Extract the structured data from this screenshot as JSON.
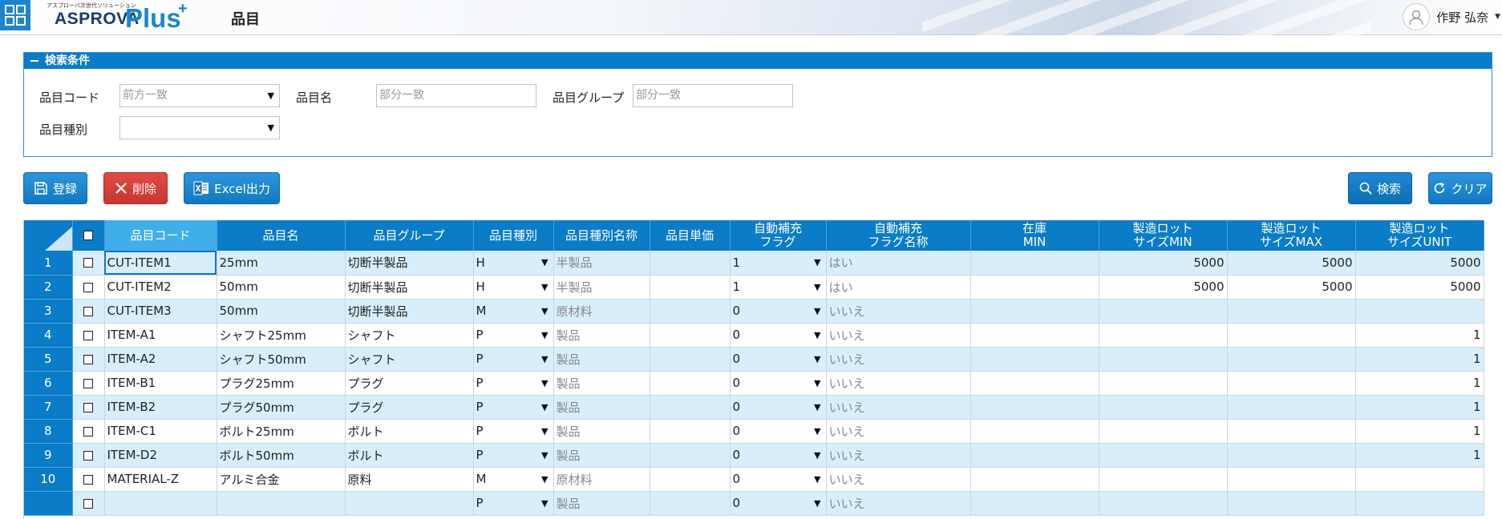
{
  "header": {
    "logo_sub": "アスプローバ次世代ソリューション",
    "logo_main": "ASPROVA",
    "logo_plus": "Plus",
    "logo_sup": "+",
    "page_title": "品目",
    "user_name": "作野 弘奈"
  },
  "search": {
    "panel_title": "検索条件",
    "item_code_label": "品目コード",
    "item_code_placeholder": "前方一致",
    "item_name_label": "品目名",
    "item_name_placeholder": "部分一致",
    "item_group_label": "品目グループ",
    "item_group_placeholder": "部分一致",
    "item_type_label": "品目種別",
    "item_type_value": ""
  },
  "toolbar": {
    "register": "登録",
    "delete": "削除",
    "excel": "Excel出力",
    "search": "検索",
    "clear": "クリア"
  },
  "grid": {
    "columns": [
      "品目コード",
      "品目名",
      "品目グループ",
      "品目種別",
      "品目種別名称",
      "品目単価",
      "自動補充\nフラグ",
      "自動補充\nフラグ名称",
      "在庫\nMIN",
      "製造ロット\nサイズMIN",
      "製造ロット\nサイズMAX",
      "製造ロット\nサイズUNIT"
    ],
    "rows": [
      {
        "no": "1",
        "code": "CUT-ITEM1",
        "name": "25mm",
        "group": "切断半製品",
        "type": "H",
        "type_name": "半製品",
        "price": "",
        "flag": "1",
        "flag_name": "はい",
        "stock_min": "",
        "lot_min": "5000",
        "lot_max": "5000",
        "lot_unit": "5000"
      },
      {
        "no": "2",
        "code": "CUT-ITEM2",
        "name": "50mm",
        "group": "切断半製品",
        "type": "H",
        "type_name": "半製品",
        "price": "",
        "flag": "1",
        "flag_name": "はい",
        "stock_min": "",
        "lot_min": "5000",
        "lot_max": "5000",
        "lot_unit": "5000"
      },
      {
        "no": "3",
        "code": "CUT-ITEM3",
        "name": "50mm",
        "group": "切断半製品",
        "type": "M",
        "type_name": "原材料",
        "price": "",
        "flag": "0",
        "flag_name": "いいえ",
        "stock_min": "",
        "lot_min": "",
        "lot_max": "",
        "lot_unit": ""
      },
      {
        "no": "4",
        "code": "ITEM-A1",
        "name": "シャフト25mm",
        "group": "シャフト",
        "type": "P",
        "type_name": "製品",
        "price": "",
        "flag": "0",
        "flag_name": "いいえ",
        "stock_min": "",
        "lot_min": "",
        "lot_max": "",
        "lot_unit": "1"
      },
      {
        "no": "5",
        "code": "ITEM-A2",
        "name": "シャフト50mm",
        "group": "シャフト",
        "type": "P",
        "type_name": "製品",
        "price": "",
        "flag": "0",
        "flag_name": "いいえ",
        "stock_min": "",
        "lot_min": "",
        "lot_max": "",
        "lot_unit": "1"
      },
      {
        "no": "6",
        "code": "ITEM-B1",
        "name": "プラグ25mm",
        "group": "プラグ",
        "type": "P",
        "type_name": "製品",
        "price": "",
        "flag": "0",
        "flag_name": "いいえ",
        "stock_min": "",
        "lot_min": "",
        "lot_max": "",
        "lot_unit": "1"
      },
      {
        "no": "7",
        "code": "ITEM-B2",
        "name": "プラグ50mm",
        "group": "プラグ",
        "type": "P",
        "type_name": "製品",
        "price": "",
        "flag": "0",
        "flag_name": "いいえ",
        "stock_min": "",
        "lot_min": "",
        "lot_max": "",
        "lot_unit": "1"
      },
      {
        "no": "8",
        "code": "ITEM-C1",
        "name": "ボルト25mm",
        "group": "ボルト",
        "type": "P",
        "type_name": "製品",
        "price": "",
        "flag": "0",
        "flag_name": "いいえ",
        "stock_min": "",
        "lot_min": "",
        "lot_max": "",
        "lot_unit": "1"
      },
      {
        "no": "9",
        "code": "ITEM-D2",
        "name": "ボルト50mm",
        "group": "ボルト",
        "type": "P",
        "type_name": "製品",
        "price": "",
        "flag": "0",
        "flag_name": "いいえ",
        "stock_min": "",
        "lot_min": "",
        "lot_max": "",
        "lot_unit": "1"
      },
      {
        "no": "10",
        "code": "MATERIAL-Z",
        "name": "アルミ合金",
        "group": "原料",
        "type": "M",
        "type_name": "原材料",
        "price": "",
        "flag": "0",
        "flag_name": "いいえ",
        "stock_min": "",
        "lot_min": "",
        "lot_max": "",
        "lot_unit": ""
      },
      {
        "no": "",
        "code": "",
        "name": "",
        "group": "",
        "type": "P",
        "type_name": "製品",
        "price": "",
        "flag": "0",
        "flag_name": "いいえ",
        "stock_min": "",
        "lot_min": "",
        "lot_max": "",
        "lot_unit": ""
      }
    ]
  }
}
